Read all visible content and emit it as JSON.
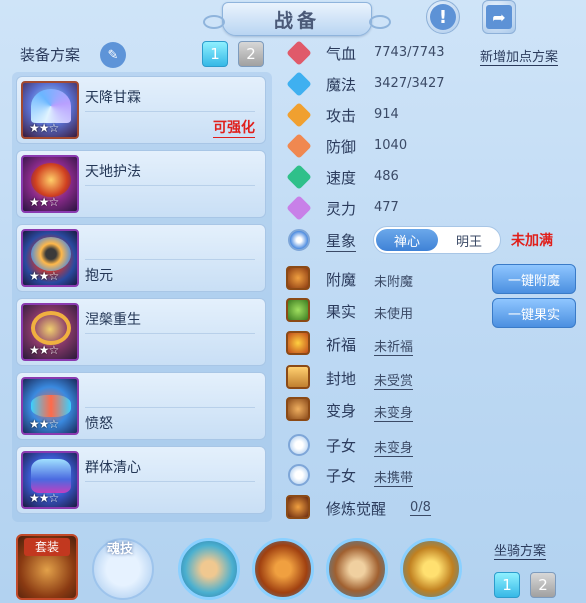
{
  "header": {
    "title": "战备",
    "help_icon": "help-icon",
    "share_icon": "share-icon"
  },
  "plan": {
    "label": "装备方案",
    "buttons": [
      "1",
      "2"
    ],
    "active": "1"
  },
  "equipment": [
    {
      "name": "天降甘霖",
      "stars": "★★☆",
      "tag": "可强化"
    },
    {
      "name": "天地护法",
      "stars": "★★☆",
      "tag": ""
    },
    {
      "name": "抱元",
      "stars": "★★☆",
      "tag": ""
    },
    {
      "name": "涅槃重生",
      "stars": "★★☆",
      "tag": ""
    },
    {
      "name": "愤怒",
      "stars": "★★☆",
      "tag": ""
    },
    {
      "name": "群体清心",
      "stars": "★★☆",
      "tag": ""
    }
  ],
  "stats": [
    {
      "name": "气血",
      "value": "7743/7743",
      "icon": "heart-icon",
      "color": "#e05a6a"
    },
    {
      "name": "魔法",
      "value": "3427/3427",
      "icon": "mana-icon",
      "color": "#3fb0f0"
    },
    {
      "name": "攻击",
      "value": "914",
      "icon": "sword-icon",
      "color": "#f0a030"
    },
    {
      "name": "防御",
      "value": "1040",
      "icon": "shield-icon",
      "color": "#f08850"
    },
    {
      "name": "速度",
      "value": "486",
      "icon": "speed-icon",
      "color": "#2fc08a"
    },
    {
      "name": "灵力",
      "value": "477",
      "icon": "spirit-icon",
      "color": "#c880e8"
    }
  ],
  "add_plan_label": "新增加点方案",
  "star_image": {
    "label": "星象",
    "options": [
      "禅心",
      "明王"
    ],
    "selected": "禅心",
    "status": "未加满"
  },
  "extras": [
    {
      "name": "附魔",
      "value": "未附魔",
      "icon": "enchant-icon",
      "underline": false
    },
    {
      "name": "果实",
      "value": "未使用",
      "icon": "fruit-icon",
      "underline": false
    },
    {
      "name": "祈福",
      "value": "未祈福",
      "icon": "bless-icon",
      "underline": true
    },
    {
      "name": "封地",
      "value": "未受赏",
      "icon": "fief-icon",
      "underline": true
    },
    {
      "name": "变身",
      "value": "未变身",
      "icon": "transform-icon",
      "underline": true
    },
    {
      "name": "子女",
      "value": "未变身",
      "icon": "child-icon",
      "underline": true
    },
    {
      "name": "子女",
      "value": "未携带",
      "icon": "pet-paw-icon",
      "underline": true
    },
    {
      "name": "修炼觉醒",
      "value": "0/8",
      "icon": "awaken-icon",
      "underline": true
    }
  ],
  "actions": {
    "enchant": "一键附魔",
    "fruit": "一键果实"
  },
  "bottom": {
    "suit_label": "套装",
    "soul_label": "魂技",
    "mount_plan_label": "坐骑方案",
    "mount_buttons": [
      "1",
      "2"
    ],
    "mount_active": "1"
  }
}
